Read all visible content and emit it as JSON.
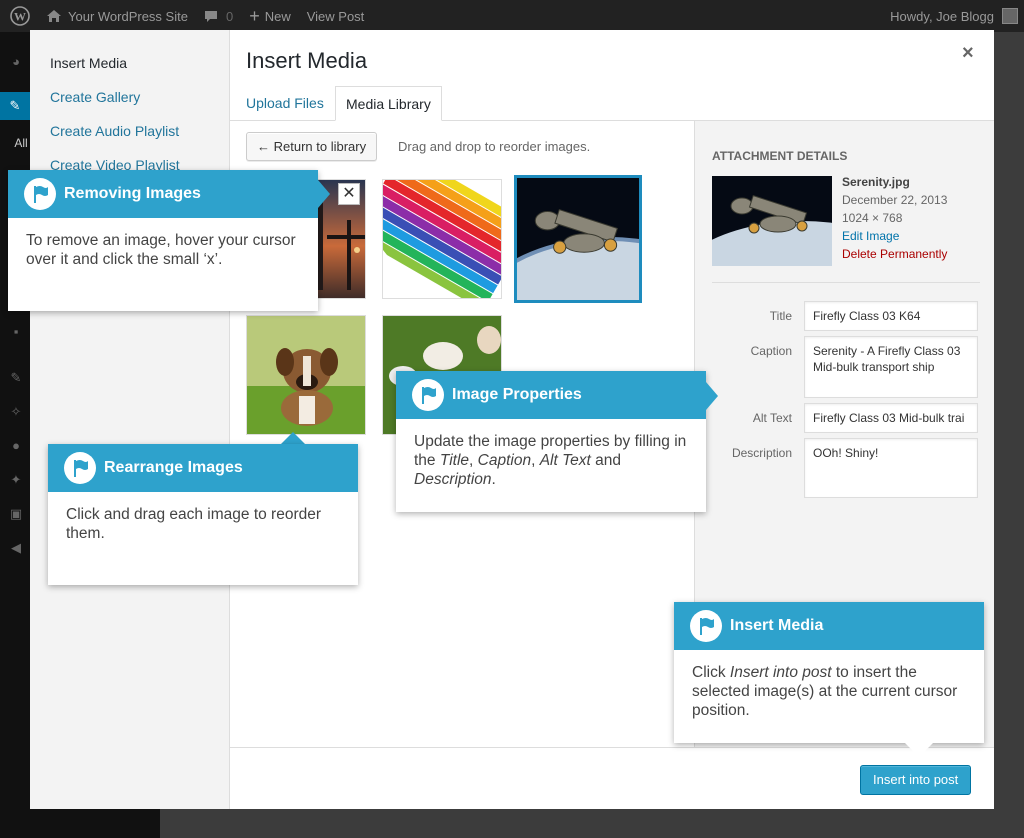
{
  "adminbar": {
    "site_name": "Your WordPress Site",
    "comments_count": "0",
    "new_label": "New",
    "view_post": "View Post",
    "howdy": "Howdy, Joe Blogg"
  },
  "side_menu_all": "All",
  "menu": {
    "items": [
      {
        "label": "Insert Media"
      },
      {
        "label": "Create Gallery"
      },
      {
        "label": "Create Audio Playlist"
      },
      {
        "label": "Create Video Playlist"
      }
    ]
  },
  "frame": {
    "title": "Insert Media",
    "close": "×",
    "tabs": [
      {
        "label": "Upload Files"
      },
      {
        "label": "Media Library"
      }
    ]
  },
  "library": {
    "return_button": "← Return to library",
    "hint": "Drag and drop to reorder images.",
    "remove_symbol": "✕"
  },
  "details": {
    "heading": "Attachment Details",
    "filename": "Serenity.jpg",
    "date": "December 22, 2013",
    "dimensions": "1024 × 768",
    "edit_link": "Edit Image",
    "delete_link": "Delete Permanently",
    "fields": {
      "title_label": "Title",
      "title_value": "Firefly Class 03 K64",
      "caption_label": "Caption",
      "caption_value": "Serenity - A Firefly Class 03 Mid-bulk transport ship",
      "alt_label": "Alt Text",
      "alt_value": "Firefly Class 03 Mid-bulk trai",
      "description_label": "Description",
      "description_value": "OOh! Shiny!"
    }
  },
  "toolbar": {
    "insert_button": "Insert into post"
  },
  "pointers": {
    "removing": {
      "title": "Removing Images",
      "body": "To remove an image, hover your cursor over it and click the small ‘x’."
    },
    "rearrange": {
      "title": "Rearrange Images",
      "body": "Click and drag each image to reorder them."
    },
    "properties": {
      "title": "Image Properties",
      "body_pre": "Update the image properties by filling in the ",
      "em1": "Title",
      "sep1": ", ",
      "em2": "Caption",
      "sep2": ", ",
      "em3": "Alt Text",
      "sep3": " and ",
      "em4": "Description",
      "end": "."
    },
    "insert": {
      "title": "Insert Media",
      "body_pre": "Click ",
      "em": "Insert into post",
      "body_post": " to insert the selected image(s) at the current cursor position."
    }
  },
  "colors": {
    "accent": "#2ea2cc",
    "link": "#21759b",
    "delete": "#aa0000",
    "adminbar": "#222222"
  }
}
